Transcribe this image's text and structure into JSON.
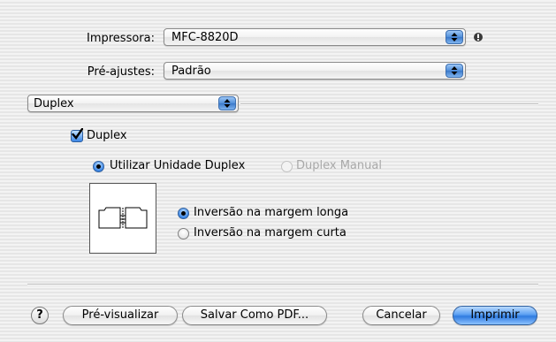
{
  "printer": {
    "label": "Impressora:",
    "value": "MFC-8820D"
  },
  "presets": {
    "label": "Pré-ajustes:",
    "value": "Padrão"
  },
  "panel_menu": {
    "value": "Duplex"
  },
  "duplex_checkbox": {
    "label": "Duplex",
    "checked": true
  },
  "mode": {
    "use_unit": {
      "label": "Utilizar Unidade Duplex",
      "selected": true
    },
    "manual": {
      "label": "Duplex Manual",
      "enabled": false
    }
  },
  "binding": {
    "long_edge": {
      "label": "Inversão na margem longa",
      "selected": true
    },
    "short_edge": {
      "label": "Inversão na margem curta",
      "selected": false
    }
  },
  "buttons": {
    "help": "?",
    "preview": "Pré-visualizar",
    "save_pdf": "Salvar Como PDF...",
    "cancel": "Cancelar",
    "print": "Imprimir"
  },
  "colors": {
    "accent": "#3b86e6",
    "window_bg": "#ececec"
  },
  "icons": {
    "stepper": "up-down-arrows-icon",
    "info": "info-dot-icon",
    "help": "help-icon",
    "check": "checkmark-icon"
  }
}
